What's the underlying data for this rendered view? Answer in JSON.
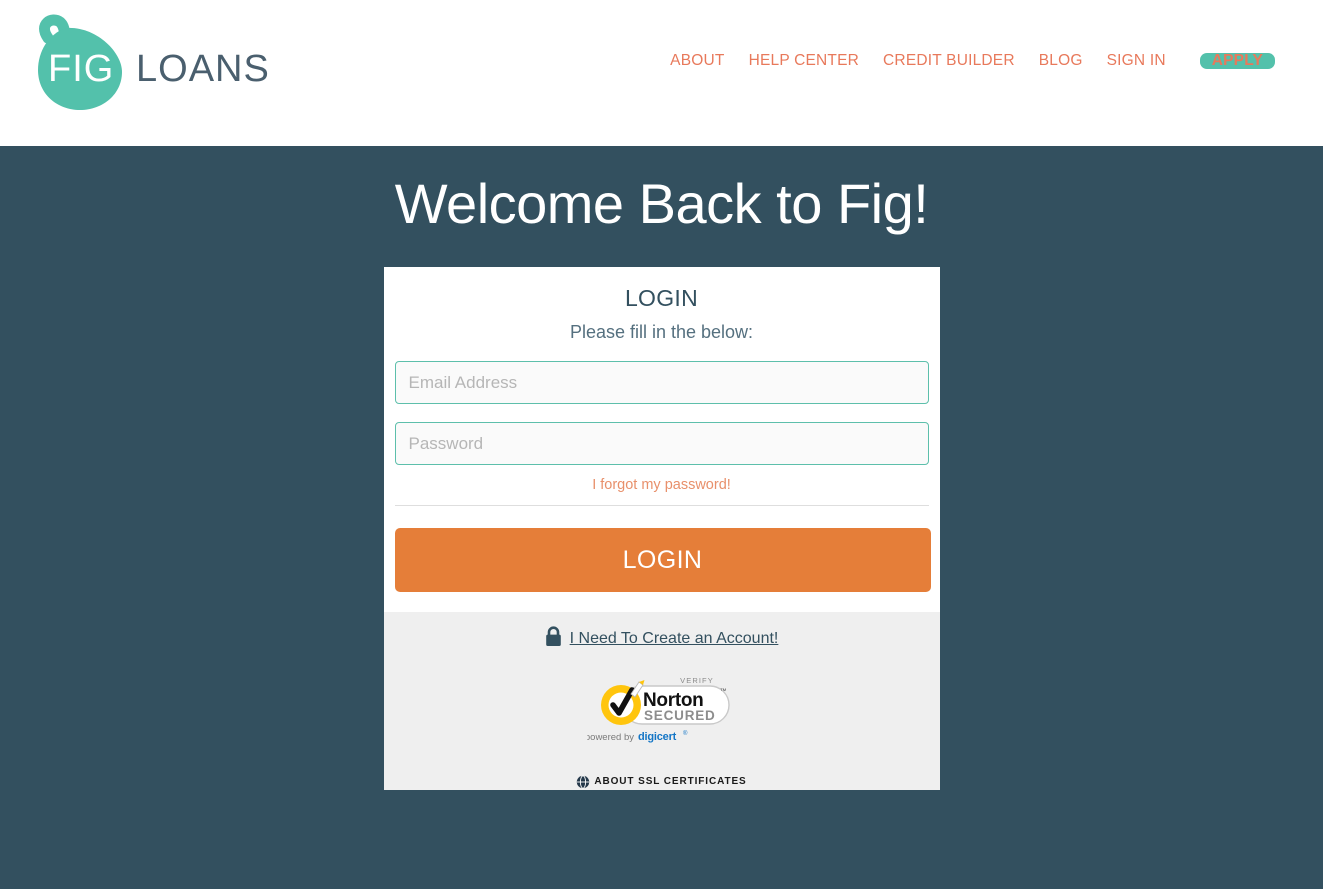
{
  "header": {
    "logo": {
      "mark_text": "FIG",
      "word_text": "LOANS",
      "teal": "#53c1ab",
      "slate": "#4a5f6e"
    },
    "nav": [
      {
        "label": "ABOUT",
        "name": "nav-about"
      },
      {
        "label": "HELP CENTER",
        "name": "nav-help-center"
      },
      {
        "label": "CREDIT BUILDER",
        "name": "nav-credit-builder"
      },
      {
        "label": "BLOG",
        "name": "nav-blog"
      },
      {
        "label": "SIGN IN",
        "name": "nav-sign-in"
      }
    ],
    "apply_label": "APPLY",
    "nav_color": "#e8795b",
    "apply_bg": "#53c1ab"
  },
  "hero": {
    "title": "Welcome Back to Fig!",
    "bg_color": "#33505f",
    "text_color": "#ffffff"
  },
  "login_card": {
    "title": "LOGIN",
    "subtitle": "Please fill in the below:",
    "email": {
      "value": "",
      "placeholder": "Email Address"
    },
    "password": {
      "value": "",
      "placeholder": "Password"
    },
    "forgot_link": "I forgot my password!",
    "submit_label": "LOGIN",
    "submit_bg": "#e57e39",
    "input_border": "#5dbfab",
    "footer": {
      "create_account_link": "I Need To Create an Account!",
      "lock_icon": "lock-icon",
      "badge": {
        "verify_text": "VERIFY",
        "brand": "Norton",
        "trademark": "™",
        "secured": "SECURED",
        "powered_by": "powered by",
        "partner": "digicert",
        "partner_tm": "®",
        "ssl_text": "ABOUT SSL CERTIFICATES",
        "ring_color": "#ffc50d",
        "partner_color": "#1476c6"
      }
    }
  }
}
